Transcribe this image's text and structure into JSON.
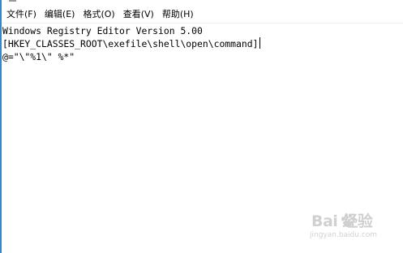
{
  "menu": {
    "file": "文件(F)",
    "edit": "编辑(E)",
    "format": "格式(O)",
    "view": "查看(V)",
    "help": "帮助(H)"
  },
  "document": {
    "lines": [
      "Windows Registry Editor Version 5.00",
      "[HKEY_CLASSES_ROOT\\exefile\\shell\\open\\command]",
      "@=\"\\\"%1\\\" %*\""
    ]
  },
  "watermark": {
    "brand": "Bai 经验",
    "url": "jingyan.baidu.com"
  },
  "colors": {
    "window_edge": "#3a84c9",
    "text": "#000000",
    "background": "#ffffff"
  },
  "icons": {
    "watermark_logo": "baidu-paw-icon"
  }
}
